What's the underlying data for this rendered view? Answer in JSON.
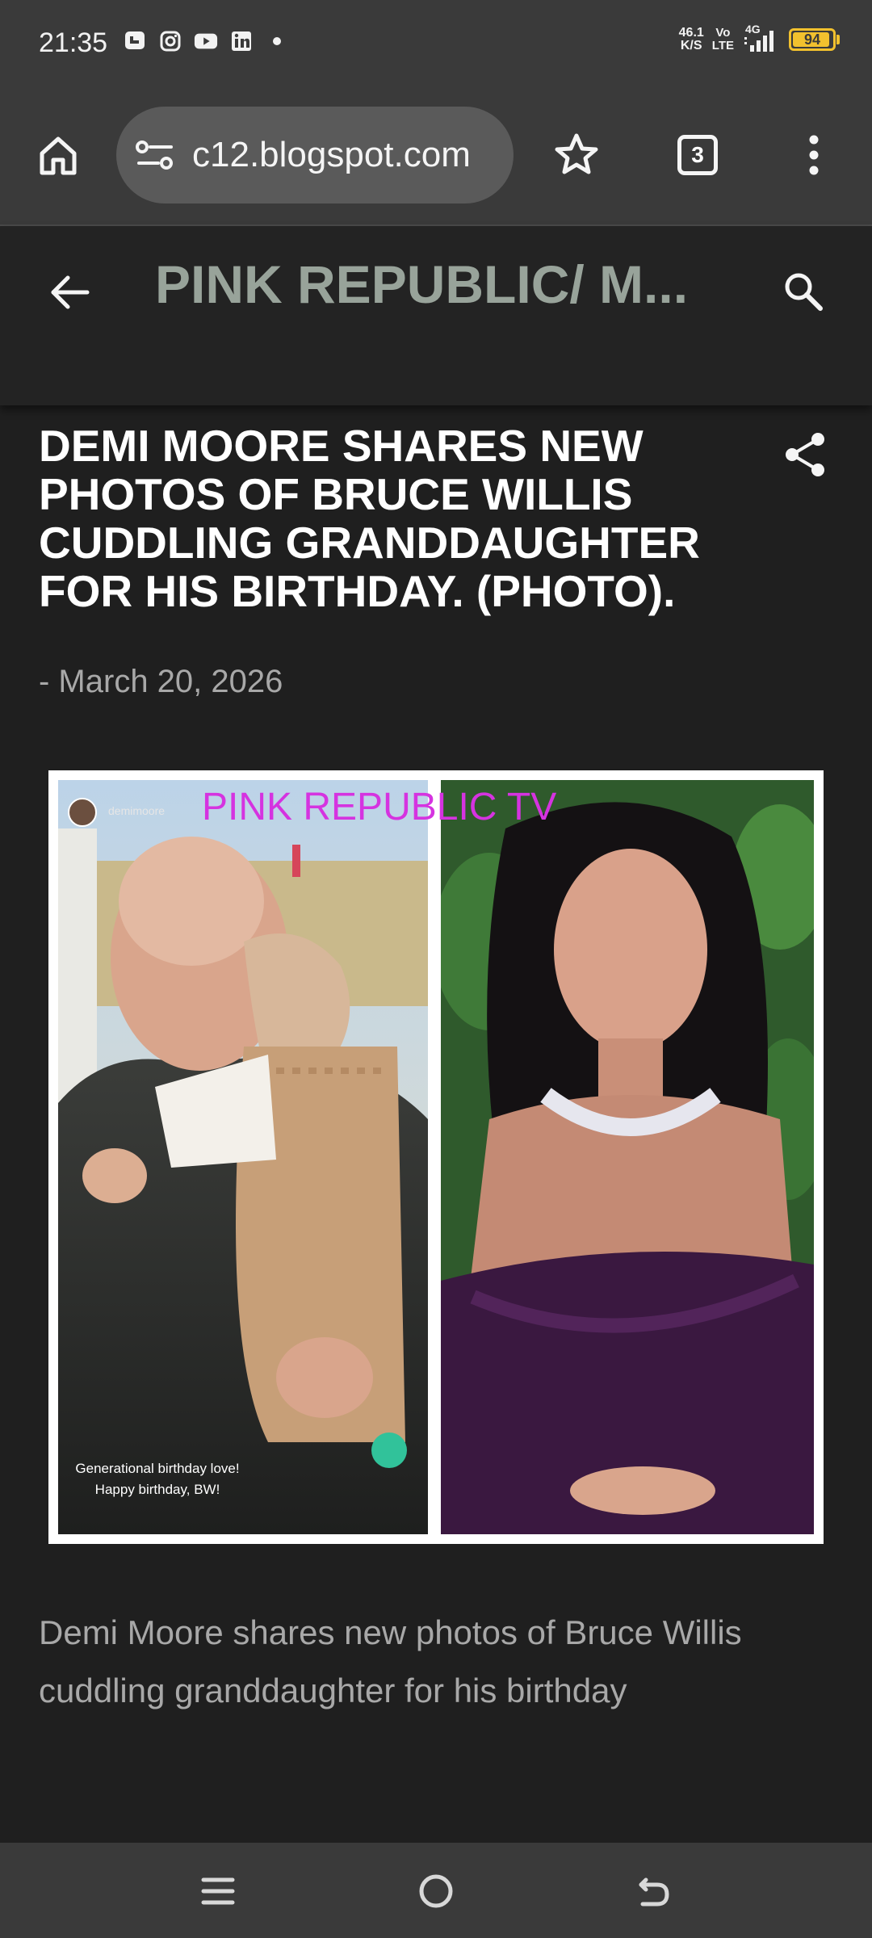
{
  "status_bar": {
    "time": "21:35",
    "notification_icons": [
      "chat-notification-icon",
      "instagram-icon",
      "youtube-icon",
      "linkedin-icon",
      "dot-icon"
    ],
    "net_speed_value": "46.1",
    "net_speed_unit": "K/S",
    "volte_top": "Vo",
    "volte_bottom": "LTE",
    "network": "4G",
    "battery": "94",
    "battery_level": 0.94
  },
  "browser": {
    "url": "c12.blogspot.com",
    "tab_count": "3"
  },
  "blog": {
    "title": "PINK REPUBLIC/ M..."
  },
  "post": {
    "title": "DEMI MOORE SHARES NEW PHOTOS OF BRUCE WILLIS CUDDLING GRANDDAUGHTER FOR HIS BIRTHDAY. (PHOTO).",
    "date": "- March 20, 2026",
    "image": {
      "watermark": "PINK REPUBLIC TV",
      "story_username": "demimoore",
      "caption_line1": "Generational birthday love!",
      "caption_line2": "Happy birthday, BW!"
    },
    "body": "Demi Moore shares new photos of Bruce Willis cuddling granddaughter for his birthday"
  },
  "colors": {
    "background": "#1f1f1f",
    "toolbar": "#3a3a3a",
    "blog_title": "#98a39a",
    "watermark": "#d533e0",
    "battery": "#f2c12e"
  }
}
